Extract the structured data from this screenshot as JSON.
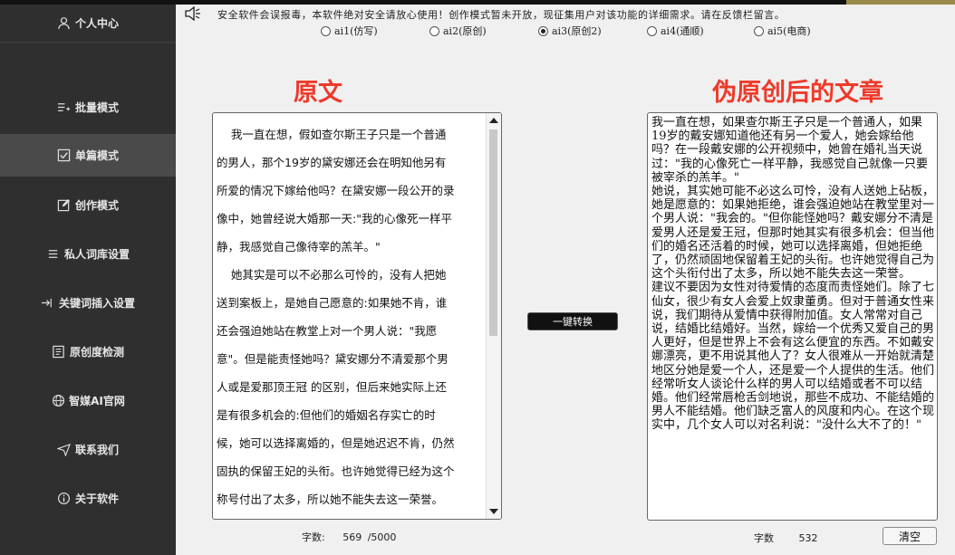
{
  "sidebar": {
    "profile_label": "个人中心",
    "items": [
      {
        "label": "批量模式",
        "icon": "list-add-icon"
      },
      {
        "label": "单篇模式",
        "icon": "checkbox-icon"
      },
      {
        "label": "创作模式",
        "icon": "edit-icon"
      },
      {
        "label": "私人词库设置",
        "icon": "lines-icon"
      },
      {
        "label": "关键词插入设置",
        "icon": "insert-icon"
      },
      {
        "label": "原创度检测",
        "icon": "document-icon"
      },
      {
        "label": "智媒AI官网",
        "icon": "globe-icon"
      },
      {
        "label": "联系我们",
        "icon": "send-icon"
      },
      {
        "label": "关于软件",
        "icon": "info-icon"
      }
    ],
    "active_item": "单篇模式"
  },
  "header": {
    "notice": "安全软件会误报毒，本软件绝对安全请放心使用！创作模式暂未开放，现征集用户对该功能的详细需求。请在反馈栏留言。"
  },
  "modes": {
    "options": [
      "ai1(仿写)",
      "ai2(原创)",
      "ai3(原创2)",
      "ai4(通顺)",
      "ai5(电商)"
    ],
    "selected": "ai3(原创2)"
  },
  "left": {
    "heading": "原文",
    "text": "    我一直在想，假如查尔斯王子只是一个普通\n的男人，那个19岁的黛安娜还会在明知他另有\n所爱的情况下嫁给他吗？在黛安娜一段公开的录\n像中，她曾经说大婚那一天:\"我的心像死一样平\n静，我感觉自己像待宰的羔羊。\"\n    她其实是可以不必那么可怜的，没有人把她\n送到案板上，是她自己愿意的:如果她不肯，谁\n还会强迫她站在教堂上对一个男人说：\"我愿\n意\"。但是能责怪她吗？黛安娜分不清爱那个男\n人或是爱那顶王冠 的区别，但后来她实际上还\n是有很多机会的:但他们的婚姻名存实亡的时\n候，她可以选择离婚的，但是她迟迟不肯，仍然\n固执的保留王妃的头衔。也许她觉得已经为这个\n称号付出了太多，所以她不能失去这一荣誉。\n    不要责怪女人对爱情的态度，除了七仙女以",
    "count_label": "字数:",
    "count_value": "569",
    "count_max": "/5000"
  },
  "convert_button": "一键转换",
  "right": {
    "heading": "伪原创后的文章",
    "text": "我一直在想，如果查尔斯王子只是一个普通人，如果19岁的戴安娜知道他还有另一个爱人，她会嫁给他吗？在一段戴安娜的公开视频中，她曾在婚礼当天说过：\"我的心像死亡一样平静，我感觉自己就像一只要被宰杀的羔羊。\"\n她说，其实她可能不必这么可怜，没有人送她上砧板，她是愿意的：如果她拒绝，谁会强迫她站在教堂里对一个男人说：\"我会的。\"但你能怪她吗？戴安娜分不清是爱男人还是爱王冠，但那时她其实有很多机会：但当他们的婚名还活着的时候，她可以选择离婚，但她拒绝了，仍然顽固地保留着王妃的头衔。也许她觉得自己为这个头衔付出了太多，所以她不能失去这一荣誉。\n建议不要因为女性对待爱情的态度而责怪她们。除了七仙女，很少有女人会爱上奴隶董勇。但对于普通女性来说，我们期待从爱情中获得附加值。女人常常对自己说，结婚比结婚好。当然，嫁给一个优秀又爱自己的男人更好，但是世界上不会有这么便宜的东西。不如戴安娜漂亮，更不用说其他人了？女人很难从一开始就清楚地区分她是爱一个人，还是爱一个人提供的生活。他们经常听女人谈论什么样的男人可以结婚或者不可以结婚。他们经常唇枪舌剑地说，那些不成功、不能结婚的男人不能结婚。他们缺乏富人的风度和内心。在这个现实中，几个女人可以对名利说：\"没什么大不了的！\"",
    "count_label": "字数",
    "count_value": "532",
    "clear_button": "清空"
  }
}
